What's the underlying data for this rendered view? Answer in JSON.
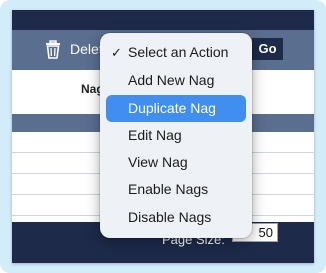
{
  "action_bar": {
    "delete_label": "Delete",
    "go_label": "Go"
  },
  "table": {
    "column_header": "Nag"
  },
  "footer": {
    "page_size_label": "Page Size:",
    "page_size_value": "50"
  },
  "action_menu": {
    "selected_index": 0,
    "highlighted_index": 2,
    "items": [
      {
        "label": "Select an Action",
        "checked": true
      },
      {
        "label": "Add New Nag"
      },
      {
        "label": "Duplicate Nag"
      },
      {
        "label": "Edit Nag"
      },
      {
        "label": "View Nag"
      },
      {
        "label": "Enable Nags"
      },
      {
        "label": "Disable Nags"
      }
    ]
  },
  "colors": {
    "outer_background": "#d3ecfa",
    "dark_navy": "#1d2a4a",
    "slate_bar": "#5a6e90",
    "highlight": "#3f8ef0"
  },
  "icons": {
    "delete": "trash-icon",
    "selected": "checkmark-icon"
  }
}
